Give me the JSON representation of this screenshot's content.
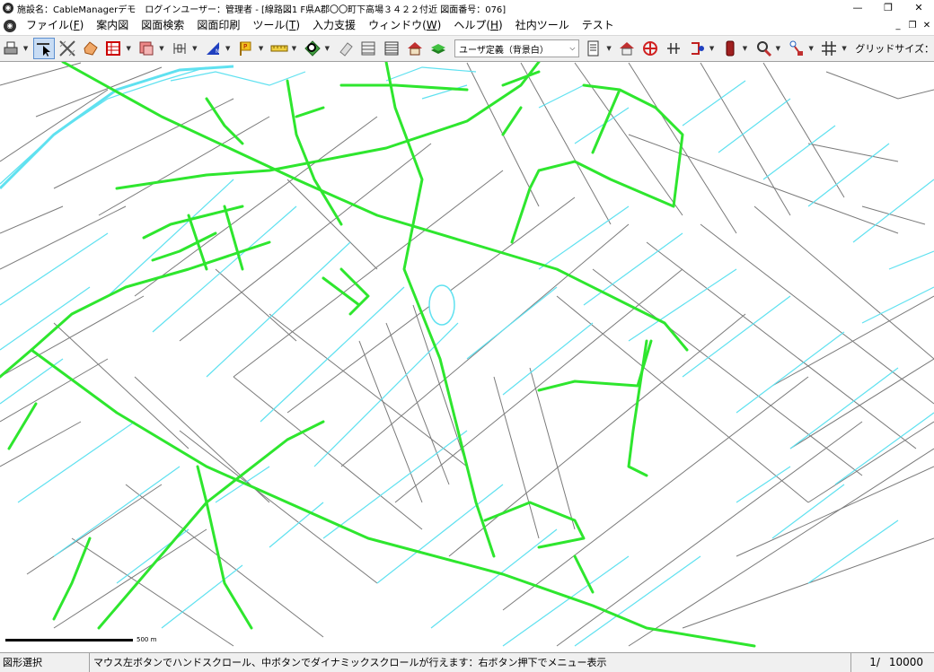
{
  "window": {
    "title": "施設名：CableManagerデモ　ログインユーザー：管理者 - [線路図1 F県A郡〇〇町下高場３４２２付近 図面番号：076]"
  },
  "menu": {
    "items": [
      {
        "label": "ファイル(",
        "key": "F",
        "suffix": ")"
      },
      {
        "label": "案内図"
      },
      {
        "label": "図面検索"
      },
      {
        "label": "図面印刷"
      },
      {
        "label": "ツール(",
        "key": "T",
        "suffix": ")"
      },
      {
        "label": "入力支援"
      },
      {
        "label": "ウィンドウ(",
        "key": "W",
        "suffix": ")"
      },
      {
        "label": "ヘルプ(",
        "key": "H",
        "suffix": ")"
      },
      {
        "label": "社内ツール"
      },
      {
        "label": "テスト"
      }
    ]
  },
  "toolbar": {
    "style_select_value": "ユーザ定義（背景白）",
    "grid_label": "グリッドサイズ："
  },
  "map": {
    "scale_label": "500 m",
    "colors": {
      "road": "#2ee62e",
      "water": "#5fe1f0",
      "parcel": "#7a7a7a"
    }
  },
  "status": {
    "mode": "図形選択",
    "message": "マウス左ボタンでハンドスクロール、中ボタンでダイナミックスクロールが行えます：右ボタン押下でメニュー表示",
    "page": "1/",
    "scale": "10000"
  }
}
